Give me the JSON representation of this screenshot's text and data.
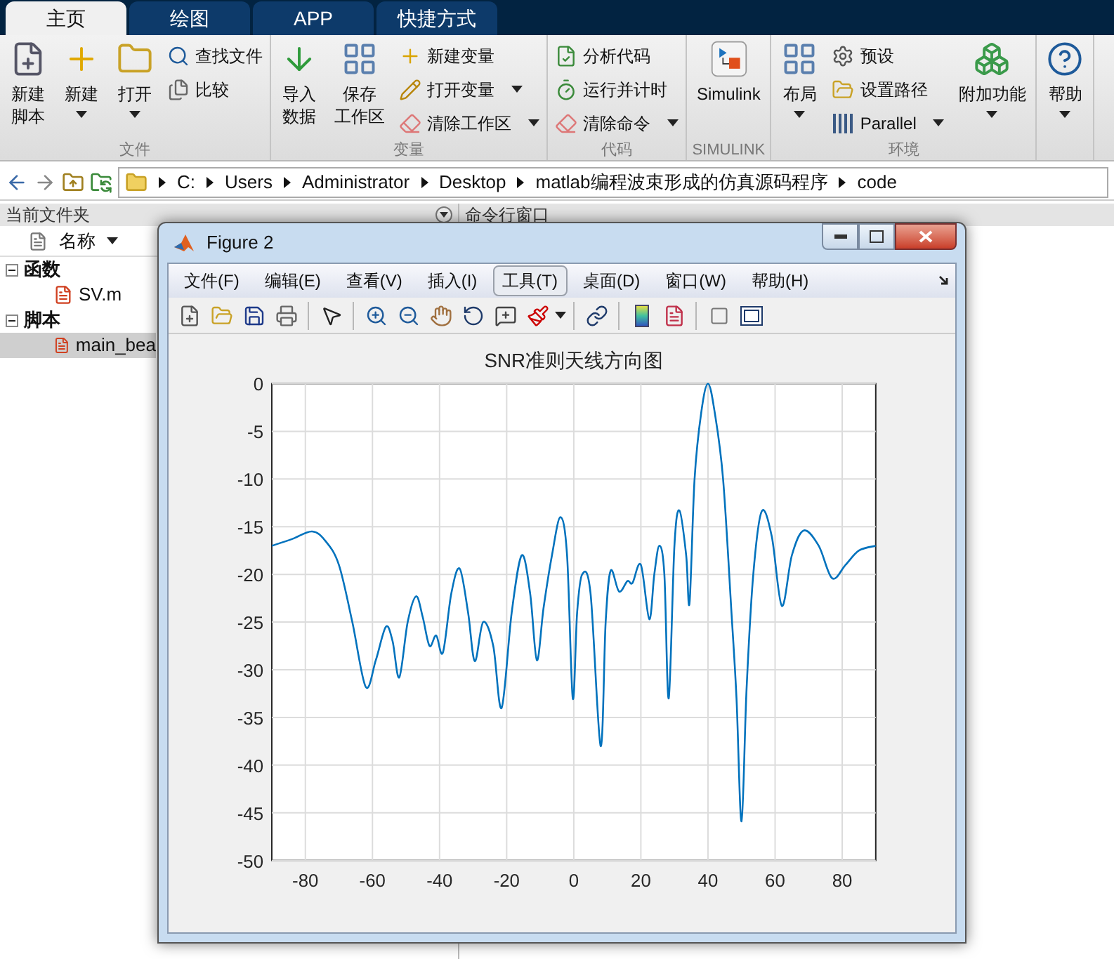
{
  "tabs": [
    {
      "label": "主页",
      "selected": true
    },
    {
      "label": "绘图",
      "selected": false
    },
    {
      "label": "APP",
      "selected": false
    },
    {
      "label": "快捷方式",
      "selected": false
    }
  ],
  "ribbon": {
    "groups": [
      {
        "label": "文件",
        "columns": [
          {
            "kind": "large",
            "lines": [
              "新建",
              "脚本"
            ],
            "dropdown": false
          },
          {
            "kind": "large",
            "lines": [
              "新建"
            ],
            "dropdown": true
          },
          {
            "kind": "large",
            "lines": [
              "打开"
            ],
            "dropdown": true
          },
          {
            "kind": "stack",
            "items": [
              {
                "label": "查找文件",
                "dropdown": false
              },
              {
                "label": "比较",
                "dropdown": false
              }
            ]
          }
        ]
      },
      {
        "label": "变量",
        "columns": [
          {
            "kind": "large",
            "lines": [
              "导入",
              "数据"
            ],
            "dropdown": false
          },
          {
            "kind": "large",
            "lines": [
              "保存",
              "工作区"
            ],
            "dropdown": false
          },
          {
            "kind": "stack",
            "items": [
              {
                "label": "新建变量",
                "dropdown": false
              },
              {
                "label": "打开变量",
                "dropdown": true
              },
              {
                "label": "清除工作区",
                "dropdown": true
              }
            ]
          }
        ]
      },
      {
        "label": "代码",
        "columns": [
          {
            "kind": "stack",
            "items": [
              {
                "label": "分析代码",
                "dropdown": false
              },
              {
                "label": "运行并计时",
                "dropdown": false
              },
              {
                "label": "清除命令",
                "dropdown": true
              }
            ]
          }
        ]
      },
      {
        "label": "SIMULINK",
        "columns": [
          {
            "kind": "large",
            "lines": [
              "Simulink"
            ],
            "dropdown": false
          }
        ]
      },
      {
        "label": "环境",
        "columns": [
          {
            "kind": "large",
            "lines": [
              "布局"
            ],
            "dropdown": true
          },
          {
            "kind": "stack",
            "items": [
              {
                "label": "预设",
                "dropdown": false
              },
              {
                "label": "设置路径",
                "dropdown": false
              },
              {
                "label": "Parallel",
                "dropdown": true
              }
            ]
          },
          {
            "kind": "large",
            "lines": [
              "附加功能"
            ],
            "dropdown": true
          }
        ]
      },
      {
        "columns": [
          {
            "kind": "large",
            "lines": [
              "帮助"
            ],
            "dropdown": true
          }
        ]
      }
    ]
  },
  "address_bar": {
    "path": [
      "C:",
      "Users",
      "Administrator",
      "Desktop",
      "matlab编程波束形成的仿真源码程序",
      "code"
    ]
  },
  "current_folder": {
    "title": "当前文件夹",
    "column": "名称",
    "tree": [
      {
        "label": "函数",
        "expanded": true,
        "children": [
          {
            "label": "SV.m",
            "selected": false
          }
        ]
      },
      {
        "label": "脚本",
        "expanded": true,
        "children": [
          {
            "label": "main_bea",
            "selected": true
          }
        ]
      }
    ]
  },
  "command_window": {
    "title": "命令行窗口"
  },
  "figure": {
    "title": "Figure 2",
    "menu": [
      {
        "label": "文件(F)",
        "selected": false
      },
      {
        "label": "编辑(E)",
        "selected": false
      },
      {
        "label": "查看(V)",
        "selected": false
      },
      {
        "label": "插入(I)",
        "selected": false
      },
      {
        "label": "工具(T)",
        "selected": true
      },
      {
        "label": "桌面(D)",
        "selected": false
      },
      {
        "label": "窗口(W)",
        "selected": false
      },
      {
        "label": "帮助(H)",
        "selected": false
      }
    ],
    "chart_data": {
      "type": "line",
      "grid": true,
      "title": "SNR准则天线方向图",
      "xlim": [
        -90,
        90
      ],
      "ylim": [
        -50,
        0
      ],
      "xticks": [
        -80,
        -60,
        -40,
        -20,
        0,
        20,
        40,
        60,
        80
      ],
      "yticks": [
        -50,
        -45,
        -40,
        -35,
        -30,
        -25,
        -20,
        -15,
        -10,
        -5,
        0
      ],
      "x": [
        -90,
        -84,
        -78,
        -74,
        -70,
        -66,
        -62,
        -59,
        -56,
        -54,
        -52,
        -49.5,
        -47,
        -45,
        -43,
        -41,
        -39,
        -36.5,
        -34,
        -31.5,
        -29.5,
        -27,
        -24,
        -21.5,
        -18.5,
        -15.5,
        -13,
        -11,
        -9,
        -6.5,
        -4,
        -2,
        -0.3,
        1,
        2.5,
        5,
        8,
        9.5,
        11,
        13.5,
        16,
        17.5,
        20,
        22.5,
        24,
        25.5,
        27,
        28.3,
        30,
        31.5,
        33.5,
        34.5,
        36,
        38,
        40,
        42,
        44.5,
        47,
        48.5,
        50,
        51.5,
        53.5,
        56,
        59,
        62,
        65,
        68.5,
        73,
        77,
        81,
        85,
        90
      ],
      "series": [
        {
          "color": "#0072bd",
          "values": [
            -17,
            -16.3,
            -15.5,
            -16.5,
            -19,
            -25,
            -31.8,
            -29,
            -25.5,
            -27,
            -30.8,
            -25,
            -22.3,
            -24.5,
            -27.5,
            -26.4,
            -28.2,
            -22,
            -19.4,
            -24,
            -29.1,
            -25,
            -27.5,
            -34,
            -24,
            -18,
            -22,
            -29,
            -23.5,
            -18,
            -14,
            -18,
            -33,
            -24,
            -20,
            -22,
            -38,
            -25,
            -19.6,
            -21.8,
            -20.7,
            -20.9,
            -19,
            -24.7,
            -20,
            -17,
            -20,
            -33,
            -17,
            -13.3,
            -18,
            -23,
            -10,
            -3,
            0,
            -3,
            -10,
            -24,
            -33,
            -45.9,
            -32,
            -20,
            -13.4,
            -16,
            -23.3,
            -18,
            -15.4,
            -17,
            -20.4,
            -19,
            -17.5,
            -17
          ]
        }
      ]
    }
  }
}
